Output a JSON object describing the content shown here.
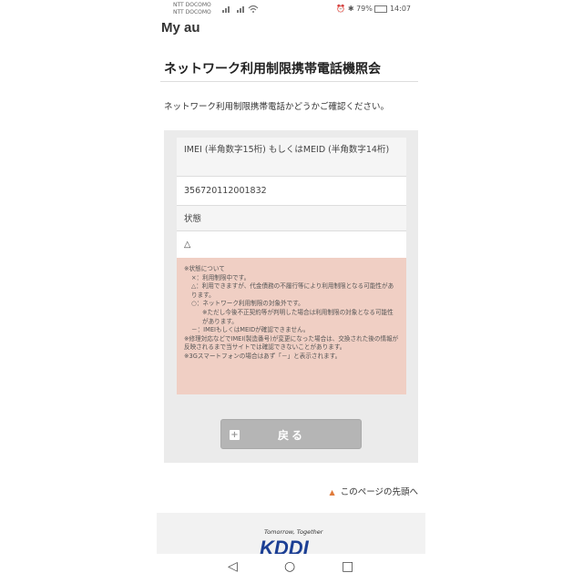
{
  "statusbar": {
    "carrier1": "NTT DOCOMO",
    "carrier2": "NTT DOCOMO",
    "battery": "79%",
    "time": "14:07"
  },
  "header": {
    "brand": "My au"
  },
  "main": {
    "title": "ネットワーク利用制限携帯電話機照会",
    "intro": "ネットワーク利用制限携帯電話かどうかご確認ください。",
    "imei_label": "IMEI (半角数字15桁) もしくはMEID (半角数字14桁)",
    "imei_value": "356720112001832",
    "status_label": "状態",
    "status_value": "△",
    "notes": [
      "※状態について",
      "×：利用制限中です。",
      "△：利用できますが、代金債務の不履行等により利用制限となる可能性があります。",
      "○：ネットワーク利用制限の対象外です。",
      "※ただし今後不正契約等が判明した場合は利用制限の対象となる可能性があります。",
      "－：IMEIもしくはMEIDが確認できません。",
      "※修理対応などでIMEI(製造番号)が変更になった場合は、交換された後の情報が反映されるまで当サイトでは確認できないことがあります。",
      "※3Gスマートフォンの場合はあず「－」と表示されます。"
    ],
    "back_label": "戻る",
    "page_top": "このページの先頭へ"
  },
  "footer": {
    "tagline": "Tomorrow, Together",
    "logo_text": "KDDI"
  },
  "colors": {
    "notes_bg": "#f0cfc4",
    "panel_bg": "#ebebeb",
    "button_bg": "#b5b5b5",
    "accent": "#e07a3a"
  },
  "navbar": {
    "back": "◁",
    "home": "○",
    "recents": "□"
  }
}
